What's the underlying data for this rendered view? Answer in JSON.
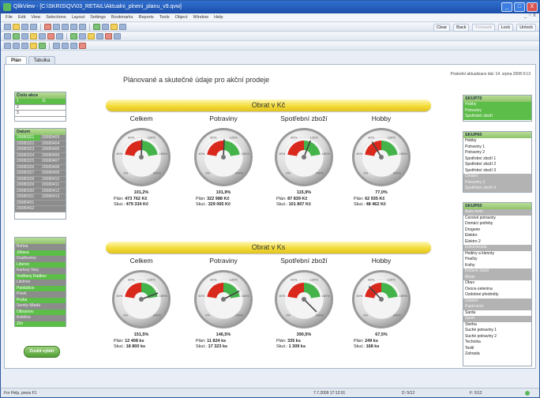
{
  "window": {
    "title": "QlikView - [C:\\SKRIS\\QV\\03_RETAIL\\Aktualni_plneni_planu_v9.qvw]",
    "controls": [
      "_",
      "□",
      "X"
    ]
  },
  "menu": {
    "items": [
      "File",
      "Edit",
      "View",
      "Selections",
      "Layout",
      "Settings",
      "Bookmarks",
      "Reports",
      "Tools",
      "Object",
      "Window",
      "Help"
    ],
    "mdi_controls": "_ ♂ X"
  },
  "toolbar_right": {
    "clear": "Clear",
    "back": "Back",
    "forward": "Forward",
    "lock": "Lock",
    "unlock": "Unlock"
  },
  "tabs": [
    "Plán",
    "Tabulka"
  ],
  "sheet": {
    "title": "Plánované a skutečné údaje pro akční prodeje",
    "last_update": "Poslední aktualizace dat: 14. srpna 2008 9:13"
  },
  "listboxes": {
    "cislo_akce": {
      "header": "Číslo akce",
      "items": [
        [
          "1",
          "11"
        ],
        [
          "2",
          ""
        ],
        [
          "3",
          ""
        ]
      ]
    },
    "datum": {
      "header": "Datum",
      "items": [
        [
          "20080321",
          "20080403"
        ],
        [
          "20080322",
          "20080404"
        ],
        [
          "20080323",
          "20080405"
        ],
        [
          "20080324",
          "20080406"
        ],
        [
          "20080325",
          "20080407"
        ],
        [
          "20080326",
          "20080408"
        ],
        [
          "20080327",
          "20080409"
        ],
        [
          "20080328",
          "20080410"
        ],
        [
          "20080329",
          "20080411"
        ],
        [
          "20080330",
          "20080412"
        ],
        [
          "20080331",
          "20080413"
        ],
        [
          "20080401",
          ""
        ],
        [
          "20080402",
          ""
        ]
      ]
    },
    "stores": {
      "header": "",
      "items": [
        "Bořina",
        "Jihlava",
        "Dražkovice",
        "Liberec",
        "Karlovy Vary",
        "Vodňany Radkov",
        "Litvínov",
        "Pardubice",
        "Písek",
        "Praha",
        "Semily Mladá",
        "Olbramov",
        "Kněžice",
        "Zlín"
      ]
    }
  },
  "clear_button": "Zrušit výběr",
  "sections": [
    {
      "band": "Obrat v Kč",
      "gauges": [
        {
          "title": "Celkem",
          "pct": "101,2%",
          "value": 1.012,
          "plan_label": "Plán:",
          "plan": "473 762 Kč",
          "skut_label": "Skut.:",
          "skut": "479 334 Kč"
        },
        {
          "title": "Potraviny",
          "pct": "101,9%",
          "value": 1.019,
          "plan_label": "Plán:",
          "plan": "322 988 Kč",
          "skut_label": "Skut.:",
          "skut": "329 065 Kč"
        },
        {
          "title": "Spotřební zboží",
          "pct": "115,9%",
          "value": 1.159,
          "plan_label": "Plán:",
          "plan": "87 839 Kč",
          "skut_label": "Skut.:",
          "skut": "101 807 Kč"
        },
        {
          "title": "Hobby",
          "pct": "77,0%",
          "value": 0.77,
          "plan_label": "Plán:",
          "plan": "62 935 Kč",
          "skut_label": "Skut.:",
          "skut": "48 462 Kč"
        }
      ]
    },
    {
      "band": "Obrat v Ks",
      "gauges": [
        {
          "title": "Celkem",
          "pct": "151,5%",
          "value": 1.515,
          "plan_label": "Plán:",
          "plan": "12 408 ks",
          "skut_label": "Skut.:",
          "skut": "18 800 ks"
        },
        {
          "title": "Potraviny",
          "pct": "146,5%",
          "value": 1.465,
          "plan_label": "Plán:",
          "plan": "11 824 ks",
          "skut_label": "Skut.:",
          "skut": "17 323 ks"
        },
        {
          "title": "Spotřební zboží",
          "pct": "390,5%",
          "value": 3.905,
          "plan_label": "Plán:",
          "plan": "335 ks",
          "skut_label": "Skut.:",
          "skut": "1 309 ks"
        },
        {
          "title": "Hobby",
          "pct": "67,5%",
          "value": 0.675,
          "plan_label": "Plán:",
          "plan": "249 ks",
          "skut_label": "Skut.:",
          "skut": "168 ks"
        }
      ]
    }
  ],
  "gauge_scale": {
    "labels": [
      "0%",
      "40%",
      "80%",
      "120%",
      "160%",
      "200%"
    ]
  },
  "right_lists": {
    "skup70": {
      "header": "SKUP70",
      "items": [
        [
          "Hobby",
          "sel"
        ],
        [
          "Potraviny",
          "sel"
        ],
        [
          "Spotřební zboží",
          "sel"
        ]
      ]
    },
    "skup60": {
      "header": "SKUP60",
      "items": [
        [
          "Hobby",
          "plain"
        ],
        [
          "Potraviny 1",
          "plain"
        ],
        [
          "Potraviny 2",
          "plain"
        ],
        [
          "Spotřební zboží 1",
          "plain"
        ],
        [
          "Spotřební zboží 2",
          "plain"
        ],
        [
          "Spotřební zboží 3",
          "plain"
        ],
        [
          "Ostatní",
          "exc"
        ],
        [
          "Potraviny 3",
          "exc"
        ],
        [
          "Spotřební zboží 4",
          "exc"
        ]
      ]
    },
    "skup50": {
      "header": "SKUP50",
      "items": [
        [
          "Auto-moto",
          "exc"
        ],
        [
          "Cerstvé potraviny",
          "plain"
        ],
        [
          "Domácí potřeby",
          "plain"
        ],
        [
          "Drogerie",
          "plain"
        ],
        [
          "Elektro",
          "plain"
        ],
        [
          "Elektro 2",
          "plain"
        ],
        [
          "Elektroinstal.",
          "exc"
        ],
        [
          "Hodiny a klenoty",
          "plain"
        ],
        [
          "Hračky",
          "plain"
        ],
        [
          "Knihy",
          "plain"
        ],
        [
          "Kožené zboží",
          "exc"
        ],
        [
          "Móda",
          "exc"
        ],
        [
          "Obuv",
          "plain"
        ],
        [
          "Ovoce-zelenina",
          "plain"
        ],
        [
          "Ozdobné předměty",
          "plain"
        ],
        [
          "Ostatní",
          "exc"
        ],
        [
          "Papírnictví",
          "exc"
        ],
        [
          "Sarda",
          "plain"
        ],
        [
          "Sport",
          "exc"
        ],
        [
          "Sterba",
          "plain"
        ],
        [
          "Suché potraviny 1",
          "plain"
        ],
        [
          "Suché potraviny 2",
          "plain"
        ],
        [
          "Technika",
          "plain"
        ],
        [
          "Textil",
          "plain"
        ],
        [
          "Zahrada",
          "plain"
        ]
      ]
    }
  },
  "status": {
    "help": "For Help, press F1",
    "timestamp": "7.7.2009 17:12:01",
    "d": "D: 5/12",
    "f": "F: 5/12"
  },
  "colors": {
    "accent_green": "#5cbd48",
    "band_yellow": "#f3dc3a",
    "gauge_red": "#d9281c",
    "gauge_green": "#44b34a"
  }
}
